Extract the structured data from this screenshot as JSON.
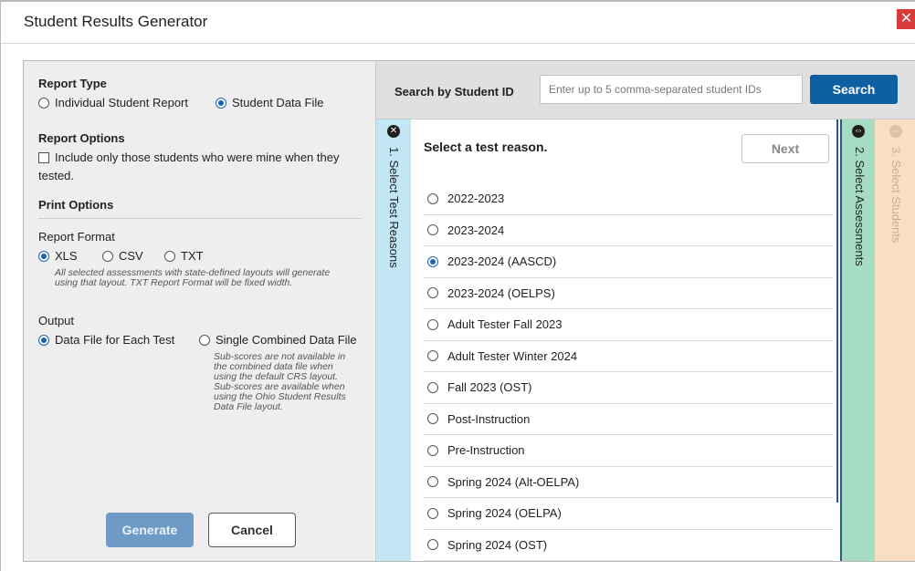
{
  "dialog": {
    "title": "Student Results Generator",
    "close_label": "✕"
  },
  "report_type": {
    "heading": "Report Type",
    "options": [
      {
        "label": "Individual Student Report",
        "selected": false
      },
      {
        "label": "Student Data File",
        "selected": true
      }
    ]
  },
  "report_options": {
    "heading": "Report Options",
    "checkbox_label": "Include only those students who were mine when they",
    "checkbox_label_2": "tested.",
    "checked": false
  },
  "print_options": {
    "heading": "Print Options"
  },
  "report_format": {
    "label": "Report Format",
    "options": [
      {
        "label": "XLS",
        "selected": true
      },
      {
        "label": "CSV",
        "selected": false
      },
      {
        "label": "TXT",
        "selected": false
      }
    ],
    "note_1": "All selected assessments with state-defined layouts will generate",
    "note_2": "using that layout. TXT Report Format will be fixed width."
  },
  "output": {
    "label": "Output",
    "options": [
      {
        "label": "Data File for Each Test",
        "selected": true
      },
      {
        "label": "Single Combined Data File",
        "selected": false
      }
    ],
    "note_lines": [
      "Sub-scores are not available in",
      "the combined data file when",
      "using the default CRS layout.",
      "Sub-scores are available when",
      "using the Ohio Student Results",
      "Data File layout."
    ]
  },
  "buttons": {
    "generate": "Generate",
    "cancel": "Cancel"
  },
  "search": {
    "label": "Search by Student ID",
    "placeholder": "Enter up to 5 comma-separated student IDs",
    "button": "Search"
  },
  "steps": [
    {
      "label": "1. Select Test Reasons",
      "icon": "close-icon"
    },
    {
      "label": "2. Select Assessments",
      "icon": "expand-arrows-icon"
    },
    {
      "label": "3. Select Students",
      "icon": "expand-arrows-icon"
    }
  ],
  "main": {
    "heading": "Select a test reason.",
    "next": "Next",
    "reasons": [
      {
        "label": "2022-2023",
        "selected": false
      },
      {
        "label": "2023-2024",
        "selected": false
      },
      {
        "label": "2023-2024 (AASCD)",
        "selected": true
      },
      {
        "label": "2023-2024 (OELPS)",
        "selected": false
      },
      {
        "label": "Adult Tester Fall 2023",
        "selected": false
      },
      {
        "label": "Adult Tester Winter 2024",
        "selected": false
      },
      {
        "label": "Fall 2023 (OST)",
        "selected": false
      },
      {
        "label": "Post-Instruction",
        "selected": false
      },
      {
        "label": "Pre-Instruction",
        "selected": false
      },
      {
        "label": "Spring 2024 (Alt-OELPA)",
        "selected": false
      },
      {
        "label": "Spring 2024 (OELPA)",
        "selected": false
      },
      {
        "label": "Spring 2024 (OST)",
        "selected": false
      }
    ]
  }
}
